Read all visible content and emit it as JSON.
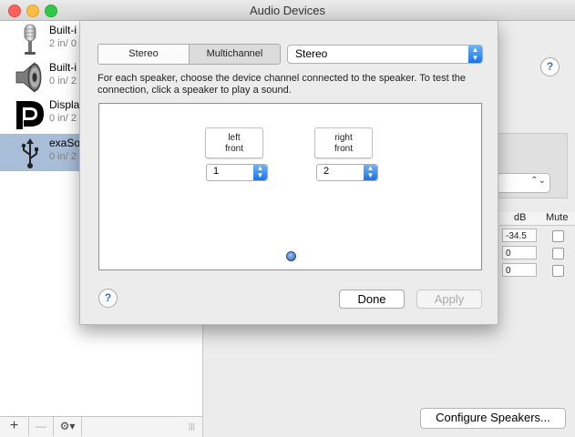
{
  "window": {
    "title": "Audio Devices"
  },
  "devices": [
    {
      "name": "Built-i",
      "channels": "2 in/ 0",
      "icon": "microphone-icon",
      "selected": false
    },
    {
      "name": "Built-i",
      "channels": "0 in/ 2",
      "icon": "speaker-icon",
      "selected": false
    },
    {
      "name": "Displa",
      "channels": "0 in/ 2",
      "icon": "displayport-icon",
      "selected": false
    },
    {
      "name": "exaSo",
      "channels": "0 in/ 2",
      "icon": "usb-icon",
      "selected": true
    }
  ],
  "bottombar": {
    "add": "+",
    "remove": "—",
    "gear": "⚙︎▾",
    "resize": "|||"
  },
  "sheet": {
    "tabs": [
      "Stereo",
      "Multichannel"
    ],
    "selected_tab": "Multichannel",
    "mode_popup": "Stereo",
    "description": "For each speaker, choose the device channel connected to the speaker. To test the connection, click a speaker to play a sound.",
    "speakers": [
      {
        "line1": "left",
        "line2": "front",
        "channel": "1"
      },
      {
        "line1": "right",
        "line2": "front",
        "channel": "2"
      }
    ],
    "help": "?",
    "done": "Done",
    "apply": "Apply"
  },
  "main": {
    "help": "?",
    "table": {
      "headers": [
        "dB",
        "Mute"
      ],
      "rows": [
        {
          "db": "-34.5"
        },
        {
          "db": "0"
        },
        {
          "db": "0"
        }
      ]
    },
    "configure_button": "Configure Speakers..."
  }
}
